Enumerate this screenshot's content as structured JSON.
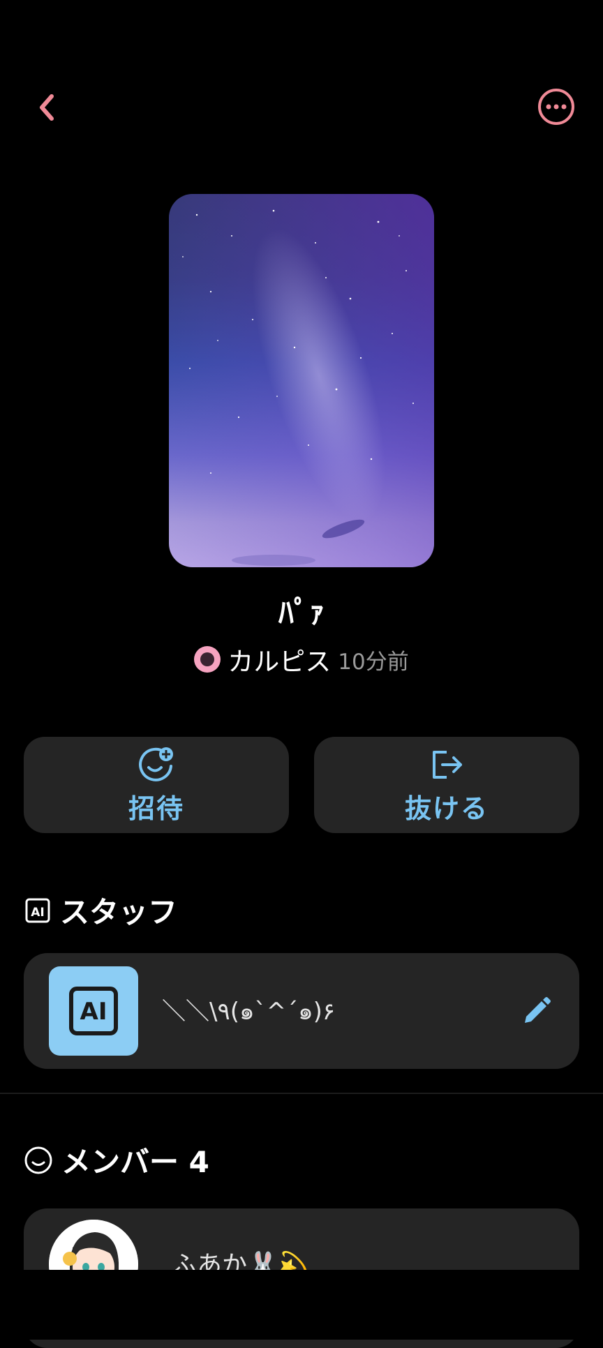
{
  "header": {
    "back_icon": "chevron-left-icon",
    "more_icon": "more-options-icon",
    "accent_color": "#f08a97"
  },
  "room": {
    "title": "ﾊﾟｧ",
    "owner_name": "カルピス",
    "owner_time": "10分前"
  },
  "actions": {
    "invite_label": "招待",
    "invite_icon": "add-user-icon",
    "leave_label": "抜ける",
    "leave_icon": "exit-icon",
    "color": "#79c4f2"
  },
  "staff": {
    "heading": "スタッフ",
    "icon": "ai-badge-icon",
    "items": [
      {
        "name": "＼＼\\٩(๑`^´๑)۶",
        "avatar_label": "AI",
        "edit_icon": "pencil-icon"
      }
    ]
  },
  "members": {
    "heading": "メンバー 4",
    "icon": "smiley-icon",
    "items": [
      {
        "name": "ふあか🐰💫"
      }
    ]
  }
}
